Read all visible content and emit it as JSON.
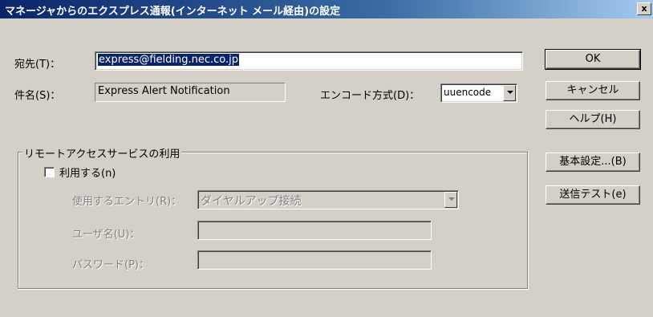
{
  "window": {
    "title": "マネージャからのエクスプレス通報(インターネット メール経由)の設定",
    "close_label": "x"
  },
  "fields": {
    "destination_label": "宛先(T)：",
    "destination_value": "express@fielding.nec.co.jp",
    "subject_label": "件名(S)：",
    "subject_value": "Express Alert Notification",
    "encode_label": "エンコード方式(D)：",
    "encode_value": "uuencode"
  },
  "buttons": {
    "ok": "OK",
    "cancel": "キャンセル",
    "help": "ヘルプ(H)",
    "basic_settings": "基本設定...(B)",
    "send_test": "送信テスト(e)"
  },
  "remote_access": {
    "group_title": "リモートアクセスサービスの利用",
    "use_checkbox_label": "利用する(n)",
    "use_checked": false,
    "entry_label": "使用するエントリ(R)：",
    "entry_value": "ダイヤルアップ接続",
    "username_label": "ユーザ名(U)：",
    "username_value": "",
    "password_label": "パスワード(P)：",
    "password_value": ""
  }
}
